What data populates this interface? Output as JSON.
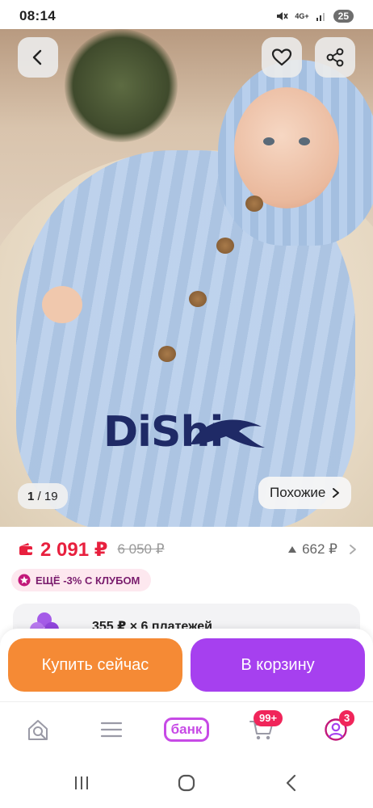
{
  "status_bar": {
    "time": "08:14",
    "network": "4G+",
    "battery": "25"
  },
  "gallery": {
    "current": "1",
    "total": "19",
    "separator": " / ",
    "similar_label": "Похожие"
  },
  "watermark_text": "DiShi",
  "price": {
    "current": "2 091 ₽",
    "old": "6 050 ₽",
    "delta": "662 ₽"
  },
  "club": {
    "label": "ЕЩЁ -3% С КЛУБОМ"
  },
  "installment": {
    "text": "355 ₽ × 6 платежей"
  },
  "actions": {
    "buy_now": "Купить сейчас",
    "to_cart": "В корзину"
  },
  "bottom_nav": {
    "bank_label": "банк",
    "cart_badge": "99+",
    "profile_badge": "3"
  },
  "colors": {
    "price": "#e8203e",
    "buy_now": "#f58a35",
    "to_cart": "#a640ef",
    "brand": "#c74ae6"
  }
}
